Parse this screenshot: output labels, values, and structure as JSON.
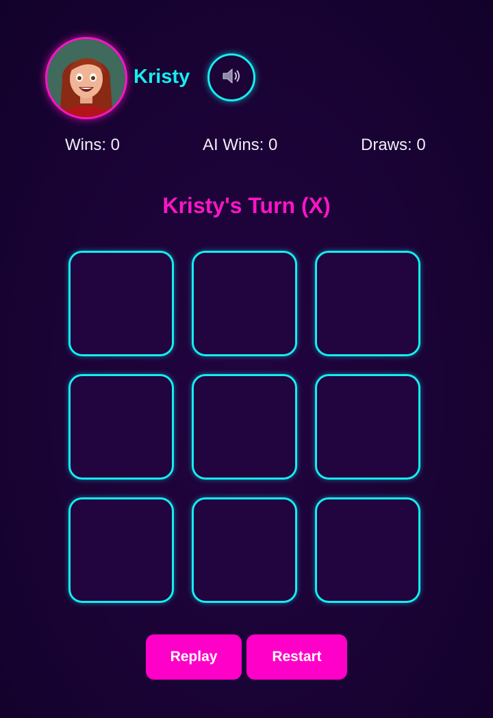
{
  "player": {
    "name": "Kristy",
    "avatar_icon": "girl-avatar-image"
  },
  "sound": {
    "icon": "speaker-icon",
    "glyph": "🔊"
  },
  "stats": {
    "wins": "Wins: 0",
    "ai_wins": "AI Wins: 0",
    "draws": "Draws: 0"
  },
  "status": {
    "turn_text": "Kristy's Turn (X)"
  },
  "board": {
    "cells": [
      "",
      "",
      "",
      "",
      "",
      "",
      "",
      "",
      ""
    ]
  },
  "controls": {
    "replay_label": "Replay",
    "restart_label": "Restart"
  },
  "colors": {
    "background": "#1a0335",
    "accent_cyan": "#14eef2",
    "accent_magenta": "#ff14c8",
    "button_magenta": "#ff00c8"
  }
}
